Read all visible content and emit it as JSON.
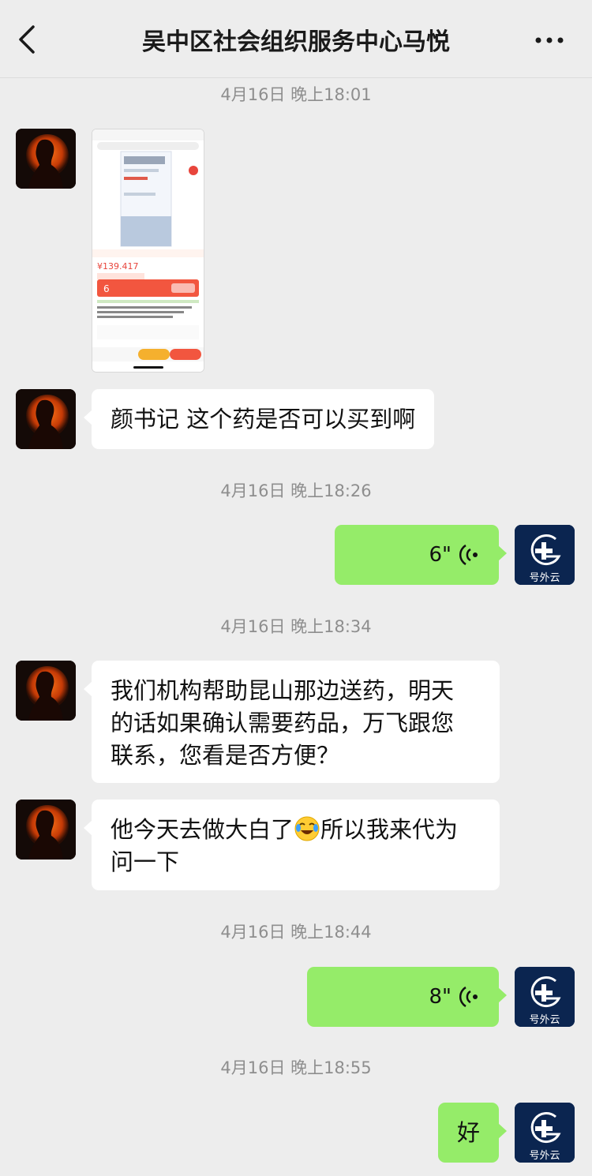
{
  "header": {
    "title": "吴中区社会组织服务中心马悦",
    "back_icon": "chevron-left-icon",
    "more_icon": "more-dots-icon"
  },
  "colors": {
    "background": "#ededed",
    "outgoing_bubble": "#95ec69",
    "incoming_bubble": "#ffffff",
    "timestamp_text": "#8e8e8e",
    "right_avatar_bg": "#0b2550"
  },
  "right_avatar": {
    "label": "号外云"
  },
  "messages": {
    "ts1": "4月16日 晚上18:01",
    "msg2": "颜书记 这个药是否可以买到啊",
    "ts2": "4月16日 晚上18:26",
    "voice1": "6\"",
    "ts3": "4月16日 晚上18:34",
    "msg3_line1": "我们机构帮助昆山那边送药，明天",
    "msg3_line2": "的话如果确认需要药品，万飞跟您",
    "msg3_line3": "联系，您看是否方便？",
    "msg4_part1": "他今天去做大白了",
    "msg4_part2": "所以我来代为",
    "msg4_line2": "问一下",
    "ts4": "4月16日 晚上18:44",
    "voice2": "8\"",
    "ts5": "4月16日 晚上18:55",
    "msg5": "好"
  },
  "screenshot_image": {
    "icon": "medicine-product-screenshot",
    "price": "¥139.417",
    "promo_label": "6"
  }
}
